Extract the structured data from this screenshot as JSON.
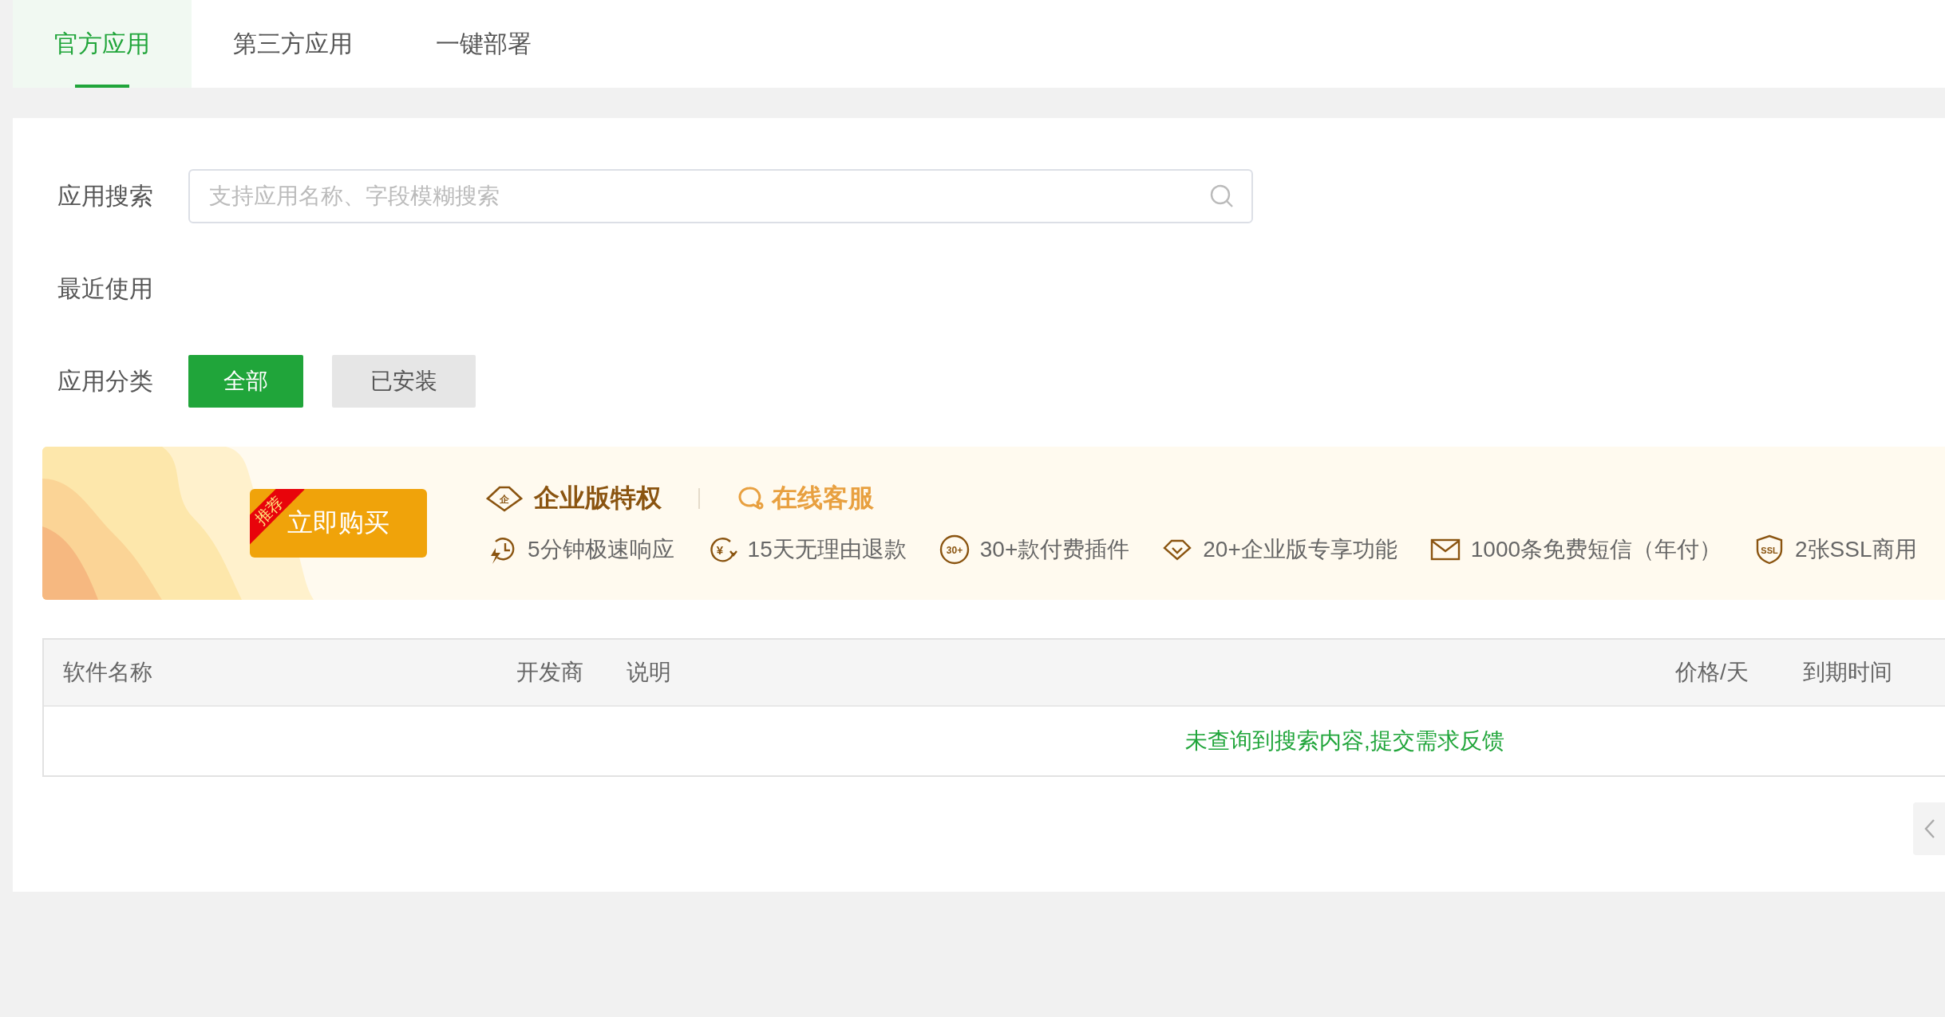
{
  "tabs": [
    {
      "label": "官方应用",
      "selected": true
    },
    {
      "label": "第三方应用",
      "selected": false
    },
    {
      "label": "一键部署",
      "selected": false
    }
  ],
  "search": {
    "label": "应用搜索",
    "placeholder": "支持应用名称、字段模糊搜索"
  },
  "recent": {
    "label": "最近使用"
  },
  "category": {
    "label": "应用分类",
    "options": [
      {
        "label": "全部",
        "selected": true
      },
      {
        "label": "已安装",
        "selected": false
      }
    ]
  },
  "promo": {
    "buy_button": "立即购买",
    "badge": "推荐",
    "title_icon_text": "企",
    "title": "企业版特权",
    "service": "在线客服",
    "features": [
      {
        "kind": "clock",
        "text": "5分钟极速响应"
      },
      {
        "kind": "refund",
        "icon_text": "¥",
        "text": "15天无理由退款"
      },
      {
        "kind": "plugins",
        "icon_text": "30+",
        "text": "30+款付费插件"
      },
      {
        "kind": "diamond",
        "text": "20+企业版专享功能"
      },
      {
        "kind": "mail",
        "text": "1000条免费短信（年付）"
      },
      {
        "kind": "ssl",
        "icon_text": "SSL",
        "text": "2张SSL商用"
      }
    ]
  },
  "table": {
    "columns": [
      "软件名称",
      "开发商",
      "说明",
      "价格/天",
      "到期时间"
    ],
    "empty_message": "未查询到搜索内容,提交需求反馈"
  }
}
